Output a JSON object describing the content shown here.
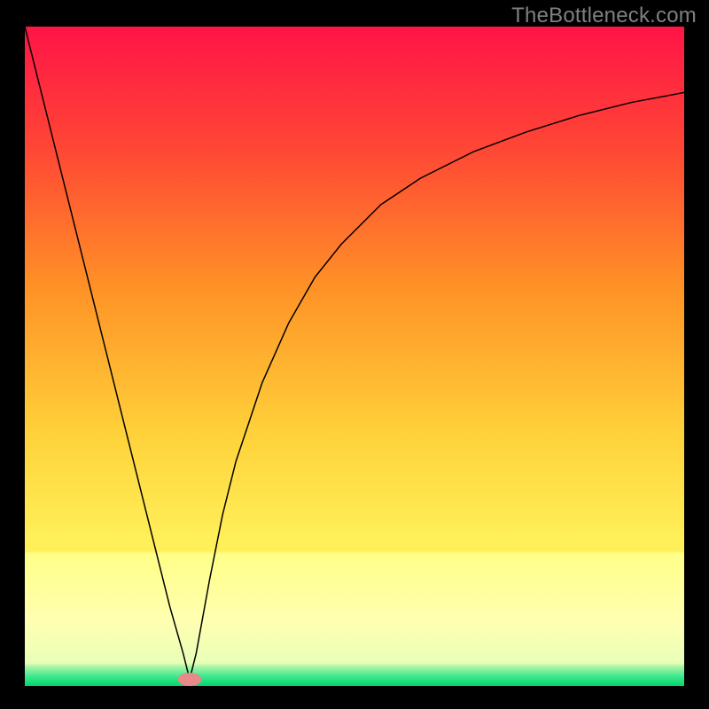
{
  "watermark": "TheBottleneck.com",
  "colors": {
    "page_bg": "#000000",
    "curve": "#000000",
    "marker_fill": "#e88a8a",
    "yellow_band": "#ffff88",
    "green_band": "#00e676",
    "gradient_top": "#ff1447",
    "gradient_upper_mid": "#ff5a2a",
    "gradient_mid": "#ffb300",
    "gradient_lower_mid": "#ffe64c",
    "gradient_yellow": "#ffff70",
    "gradient_bottom": "#00e676"
  },
  "chart_data": {
    "type": "line",
    "x": [
      0,
      2,
      4,
      6,
      8,
      10,
      12,
      14,
      16,
      18,
      20,
      22,
      24,
      25,
      26,
      28,
      30,
      32,
      36,
      40,
      44,
      48,
      54,
      60,
      68,
      76,
      84,
      92,
      100
    ],
    "values": [
      100,
      92,
      84,
      76,
      68,
      60,
      52,
      44,
      36,
      28,
      20,
      12,
      5,
      1,
      5,
      16,
      26,
      34,
      46,
      55,
      62,
      67,
      73,
      77,
      81,
      84,
      86.5,
      88.5,
      90
    ],
    "title": "",
    "xlabel": "",
    "ylabel": "",
    "xlim": [
      0,
      100
    ],
    "ylim": [
      0,
      100
    ],
    "marker": {
      "x": 25,
      "y": 1
    }
  }
}
